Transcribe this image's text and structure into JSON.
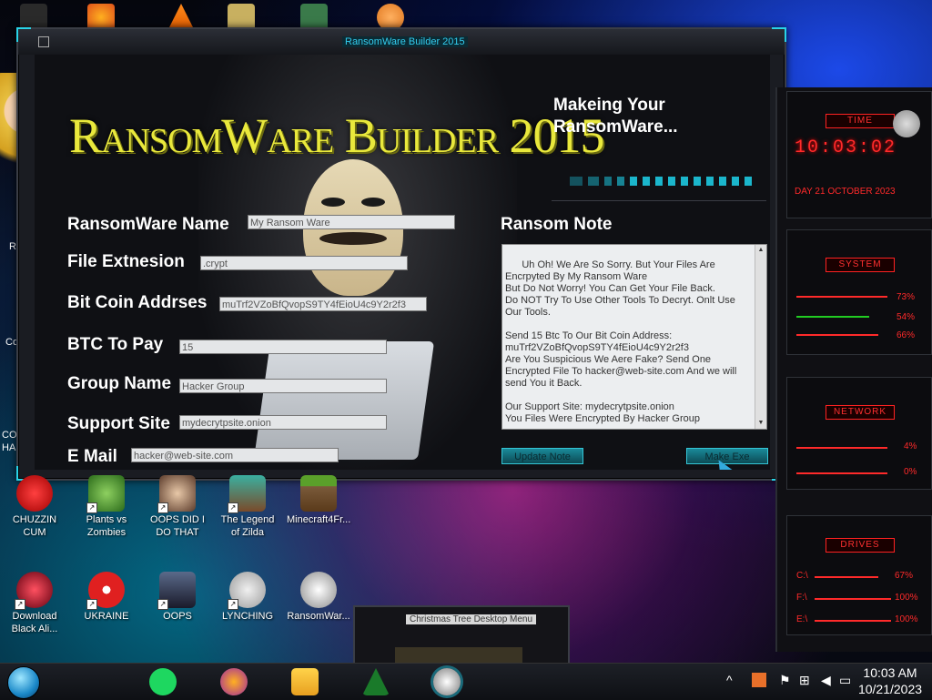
{
  "window": {
    "title": "RansomWare Builder 2015",
    "banner": "RansomWare Builder 2015",
    "status_line1": "Makeing Your",
    "status_line2": "RansomWare..."
  },
  "form": {
    "name_label": "RansomWare Name",
    "name_value": "My Ransom Ware",
    "ext_label": "File Extnesion",
    "ext_value": ".crypt",
    "btc_addr_label": "Bit Coin Addrses",
    "btc_addr_value": "muTrf2VZoBfQvopS9TY4fEioU4c9Y2r2f3",
    "btc_pay_label": "BTC To Pay",
    "btc_pay_value": "15",
    "group_label": "Group Name",
    "group_value": "Hacker Group",
    "support_label": "Support Site",
    "support_value": "mydecrytpsite.onion",
    "email_label": "E Mail",
    "email_value": "hacker@web-site.com"
  },
  "note": {
    "label": "Ransom Note",
    "text": "Uh Oh! We Are So Sorry. But Your Files Are Encrpyted By My Ransom Ware\nBut Do Not Worry! You Can Get Your File Back.\nDo NOT Try To Use Other Tools To Decryt. Onlt Use Our Tools.\n\nSend 15 Btc To Our Bit Coin Address: muTrf2VZoBfQvopS9TY4fEioU4c9Y2r2f3\nAre You Suspicious We Aere Fake? Send One Encrypted File To hacker@web-site.com And we will send You it Back.\n\nOur Support Site: mydecrytpsite.onion\nYou Files Were Encrypted By Hacker Group"
  },
  "buttons": {
    "update_note": "Update Note",
    "make_exe": "Make Exe"
  },
  "desktop_icons": [
    {
      "label": "CHUZZIN CUM",
      "color": "#d42020"
    },
    {
      "label": "Plants vs Zombies",
      "color": "#3a8a2a"
    },
    {
      "label": "OOPS DID I DO THAT",
      "color": "#6a4a3a"
    },
    {
      "label": "The Legend of Zilda",
      "color": "#2a8a7a"
    },
    {
      "label": "Minecraft4Fr...",
      "color": "#4a7a2a"
    },
    {
      "label": "Download Black Ali...",
      "color": "#8a1020"
    },
    {
      "label": "UKRAINE",
      "color": "#e02020"
    },
    {
      "label": "OOPS",
      "color": "#2a2a3a"
    },
    {
      "label": "LYNCHING",
      "color": "#c0c0c0"
    },
    {
      "label": "RansomWar...",
      "color": "#dcdcdc"
    }
  ],
  "left_edge_text": [
    "Re",
    "Co",
    "CO",
    "HA"
  ],
  "gadgets": {
    "time_title": "TIME",
    "clock": "10:03:02",
    "date": "DAY 21 OCTOBER 2023",
    "system_title": "SYSTEM",
    "sys_vals": [
      "73%",
      "54%",
      "66%"
    ],
    "network_title": "NETWORK",
    "net_vals": [
      "4%",
      "0%"
    ],
    "drives_title": "DRIVES",
    "drives": [
      {
        "name": "C:\\",
        "val": "67%"
      },
      {
        "name": "F:\\",
        "val": "100%"
      },
      {
        "name": "E:\\",
        "val": "100%"
      }
    ]
  },
  "xmas_window_title": "Christmas Tree Desktop Menu",
  "taskbar": {
    "time": "10:03 AM",
    "date": "10/21/2023"
  }
}
